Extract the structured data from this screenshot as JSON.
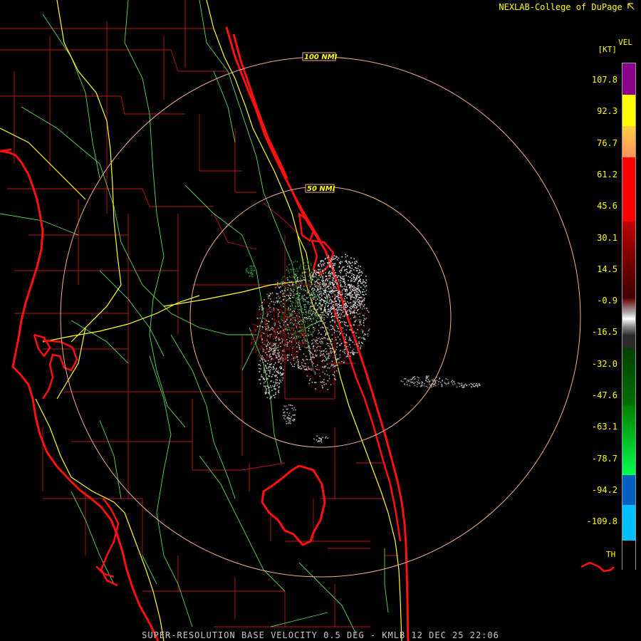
{
  "header": {
    "credit": "NEXLAB-College of DuPage"
  },
  "footer": {
    "caption": "SUPER-RESOLUTION BASE VELOCITY 0.5 DEG - KMLB 12 DEC 25 22:06"
  },
  "range_rings": [
    {
      "label": "100 NMI"
    },
    {
      "label": "50 NMI"
    }
  ],
  "legend": {
    "product": "VEL",
    "unit": "[KT]",
    "labels": [
      "107.8",
      "92.3",
      "76.7",
      "61.2",
      "45.6",
      "30.1",
      "14.5",
      "-0.9",
      "-16.5",
      "-32.0",
      "-47.6",
      "-63.1",
      "-78.7",
      "-94.2",
      "-109.8"
    ],
    "th_label": "TH",
    "colors": {
      "purple": "#8b008b",
      "yellow": "#ffff00",
      "orange": "#ffa060",
      "red": "#ff0000",
      "dark_red": "#6b0000",
      "gray": "#b4b4b4",
      "dark_green": "#005000",
      "green": "#00ee44",
      "blue": "#0060c0",
      "cyan": "#00c0ff",
      "bg": "#000000"
    }
  },
  "map_colors": {
    "coastline": "#ff1010",
    "county_lines": "#c01818",
    "highways": "#ffff30",
    "rivers_roads": "#60d860",
    "range_rings": "#f0b090"
  }
}
